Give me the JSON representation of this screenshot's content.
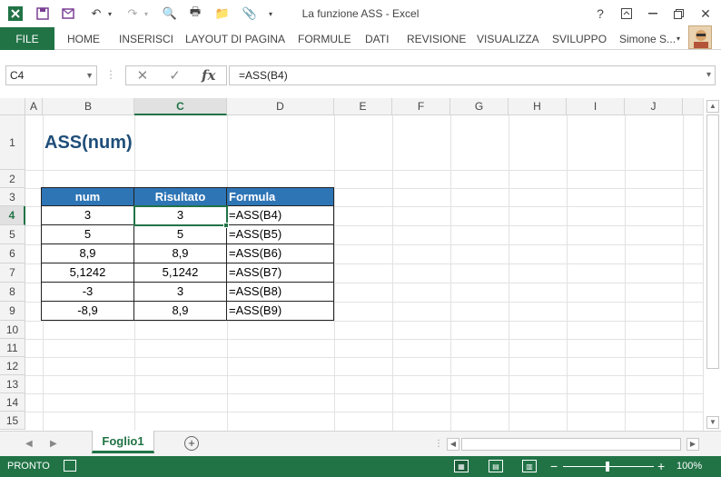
{
  "window": {
    "title": "La funzione ASS - Excel",
    "help": "?",
    "buttons": [
      "?",
      "⎘",
      "—",
      "❐",
      "✕"
    ]
  },
  "ribbon": {
    "file": "FILE",
    "tabs": [
      "HOME",
      "INSERISCI",
      "LAYOUT DI PAGINA",
      "FORMULE",
      "DATI",
      "REVISIONE",
      "VISUALIZZA",
      "SVILUPPO"
    ],
    "user": "Simone S..."
  },
  "formula_bar": {
    "name_box": "C4",
    "formula": "=ASS(B4)",
    "fx": "fx"
  },
  "grid": {
    "columns": [
      "A",
      "B",
      "C",
      "D",
      "E",
      "F",
      "G",
      "H",
      "I",
      "J"
    ],
    "selected_column": "C",
    "rows": [
      "1",
      "2",
      "3",
      "4",
      "5",
      "6",
      "7",
      "8",
      "9",
      "10",
      "11",
      "12",
      "13",
      "14",
      "15"
    ],
    "selected_row": "4",
    "title": "ASS(num)",
    "table": {
      "headers": [
        "num",
        "Risultato",
        "Formula"
      ],
      "rows": [
        [
          "3",
          "3",
          "=ASS(B4)"
        ],
        [
          "5",
          "5",
          "=ASS(B5)"
        ],
        [
          "8,9",
          "8,9",
          "=ASS(B6)"
        ],
        [
          "5,1242",
          "5,1242",
          "=ASS(B7)"
        ],
        [
          "-3",
          "3",
          "=ASS(B8)"
        ],
        [
          "-8,9",
          "8,9",
          "=ASS(B9)"
        ]
      ]
    }
  },
  "sheets": {
    "tabs": [
      "Foglio1"
    ],
    "add": "+"
  },
  "status_bar": {
    "ready": "PRONTO",
    "zoom": "100%",
    "colors": {
      "accent": "#217346",
      "table_header": "#2e75b6",
      "title": "#1f4e79"
    }
  }
}
